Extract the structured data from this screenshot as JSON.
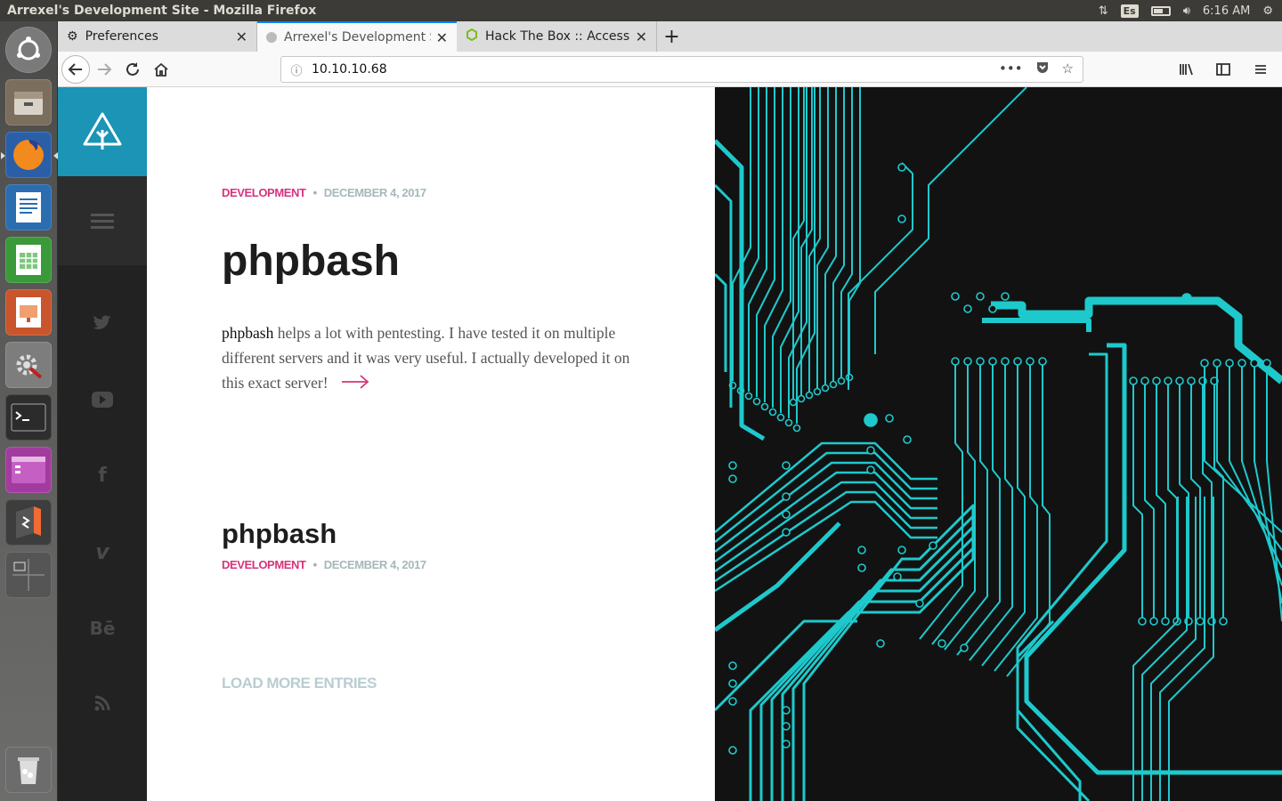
{
  "os": {
    "window_title": "Arrexel's Development Site - Mozilla Firefox",
    "keyboard_layout": "Es",
    "clock": "6:16 AM"
  },
  "launcher": {
    "apps": [
      {
        "name": "dash-home",
        "color": "#7a7a7a"
      },
      {
        "name": "files",
        "color": "#7b6e5c"
      },
      {
        "name": "firefox",
        "color": "#d94f1e"
      },
      {
        "name": "libreoffice-writer",
        "color": "#2a6db0"
      },
      {
        "name": "libreoffice-calc",
        "color": "#3a9a3a"
      },
      {
        "name": "libreoffice-impress",
        "color": "#c8552b"
      },
      {
        "name": "system-settings",
        "color": "#8a8a8a"
      },
      {
        "name": "terminal",
        "color": "#2e2e2e"
      },
      {
        "name": "purple-app",
        "color": "#a13c9e"
      },
      {
        "name": "sublime",
        "color": "#4a4a4a"
      },
      {
        "name": "workspaces",
        "color": "#555555"
      },
      {
        "name": "trash",
        "color": "#6c6c6c"
      }
    ]
  },
  "browser": {
    "tabs": [
      {
        "label": "Preferences",
        "icon": "gear-icon",
        "active": false
      },
      {
        "label": "Arrexel's Development S",
        "icon": "site-icon",
        "active": true
      },
      {
        "label": "Hack The Box :: Access",
        "icon": "htb-icon",
        "active": false
      }
    ],
    "url": "10.10.10.68",
    "page_actions": "•••"
  },
  "site": {
    "social": [
      "twitter-icon",
      "youtube-icon",
      "facebook-icon",
      "vimeo-icon",
      "behance-icon",
      "rss-icon"
    ],
    "behance_text": "Bē",
    "vimeo_text": "v",
    "facebook_text": "f",
    "posts": [
      {
        "category": "DEVELOPMENT",
        "date": "DECEMBER 4, 2017",
        "title": "phpbash",
        "excerpt_strong": "phpbash",
        "excerpt_rest": " helps a lot with pentesting. I have tested it on multiple different servers and it was very useful. I actually developed it on this exact server!"
      },
      {
        "category": "DEVELOPMENT",
        "date": "DECEMBER 4, 2017",
        "title": "phpbash"
      }
    ],
    "load_more": "LOAD MORE ENTRIES",
    "accent_color": "#1b94b5",
    "category_color": "#d6347c",
    "circuit_color": "#1ec9cc"
  }
}
